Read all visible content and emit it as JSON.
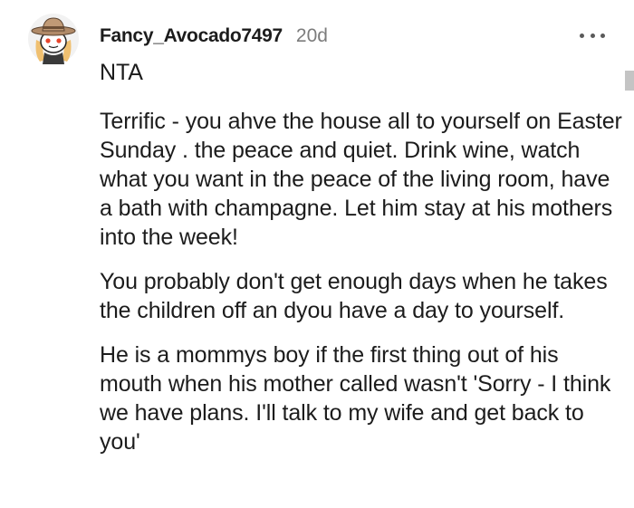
{
  "comment": {
    "username": "Fancy_Avocado7497",
    "age": "20d",
    "more_icon": "more-horizontal-icon",
    "avatar_icon": "snoo-cowboy-avatar",
    "paragraphs": [
      "NTA",
      "Terrific - you ahve the house all to yourself on Easter Sunday . the peace and quiet. Drink wine, watch what you want in the peace of the living room, have a bath with champagne. Let him stay at his mothers into the week!",
      "You probably don't get enough days when he takes the children off an dyou have a day to yourself.",
      "He is a mommys boy if the first thing out of his mouth when his mother called wasn't 'Sorry - I think we have plans. I'll talk to my wife and get back to you'"
    ]
  },
  "colors": {
    "text": "#1c1c1c",
    "meta": "#7c7c7c",
    "background": "#ffffff"
  }
}
